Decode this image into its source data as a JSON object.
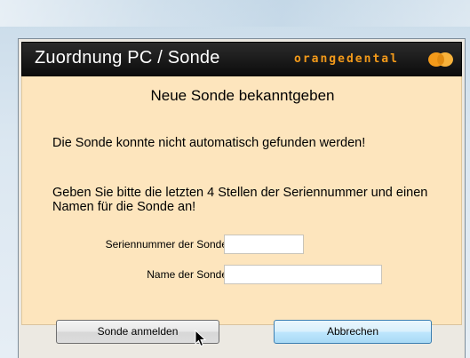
{
  "dialog": {
    "title": "Zuordnung PC / Sonde",
    "brand": "orangedental",
    "heading": "Neue Sonde bekanntgeben",
    "message_not_found": "Die Sonde konnte nicht automatisch gefunden werden!",
    "message_instructions": "Geben Sie bitte die letzten 4 Stellen der Seriennummer und einen Namen für die Sonde an!",
    "fields": {
      "serial_label": "Seriennummer der Sonde",
      "serial_value": "",
      "name_label": "Name der Sonde",
      "name_value": ""
    },
    "buttons": {
      "register": "Sonde anmelden",
      "cancel": "Abbrechen"
    }
  },
  "colors": {
    "content_bg": "#fde5bd",
    "header_bg": "#111111",
    "brand_orange": "#f39a1a"
  },
  "icons": {
    "brand_logo": "orangedental-logo-icon",
    "cursor": "mouse-cursor-icon"
  }
}
